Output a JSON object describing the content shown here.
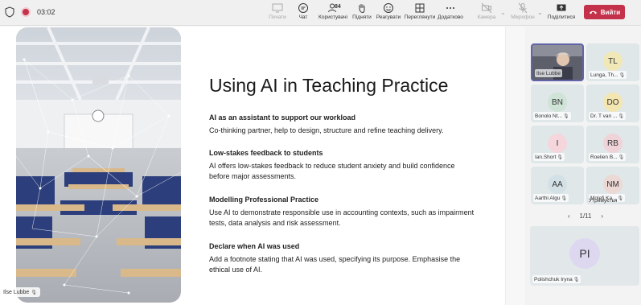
{
  "meeting": {
    "timer": "03:02"
  },
  "toolbar": {
    "share_label": "Почати",
    "chat_label": "Чат",
    "people_label": "Користувачі",
    "people_count": "84",
    "raise_label": "Підняти",
    "react_label": "Реагувати",
    "view_label": "Переглянути",
    "more_label": "Додатково",
    "camera_label": "Камера",
    "mic_label": "Мікрофон",
    "share_screen_label": "Поділитися",
    "leave_label": "Вийти",
    "leave_color": "#c4314b"
  },
  "slide": {
    "title": "Using AI in Teaching Practice",
    "sections": [
      {
        "heading": "AI as an assistant to support our workload",
        "body": "Co-thinking partner, help to design, structure and refine teaching delivery."
      },
      {
        "heading": "Low-stakes feedback to students",
        "body": "AI offers low-stakes feedback to reduce student anxiety and build confidence before major assessments."
      },
      {
        "heading": "Modelling Professional Practice",
        "body": "Use AI to demonstrate responsible use in accounting contexts, such as impairment tests, data analysis and risk assessment."
      },
      {
        "heading": "Declare when AI was used",
        "body": "Add a footnote stating that AI was used, specifying its purpose. Emphasise the ethical use of AI."
      }
    ],
    "presenter_label": "Ilse Lubbe"
  },
  "participants": {
    "tiles": [
      {
        "name": "Ilse Lubbe",
        "initials": "",
        "color": "#7a6a5e"
      },
      {
        "name": "Lunga, Th...",
        "initials": "TL",
        "color": "#f1e8b8"
      },
      {
        "name": "Bonolo Nt...",
        "initials": "BN",
        "color": "#cfe3d6"
      },
      {
        "name": "Dr. T van ...",
        "initials": "DO",
        "color": "#f3e6b0"
      },
      {
        "name": "Ian.Short",
        "initials": "I",
        "color": "#f4d6dc"
      },
      {
        "name": "Roelien B...",
        "initials": "RB",
        "color": "#efd3d9"
      },
      {
        "name": "Aarthi Algu",
        "initials": "AA",
        "color": "#d3e1e6"
      },
      {
        "name": "Molefi Ka...",
        "initials": "NM",
        "color": "#ecd8d4"
      }
    ],
    "turned_status": "Утримуєтья",
    "pager": "1/11",
    "featured": {
      "name": "Polishchuk Iryna",
      "initials": "PI"
    }
  }
}
